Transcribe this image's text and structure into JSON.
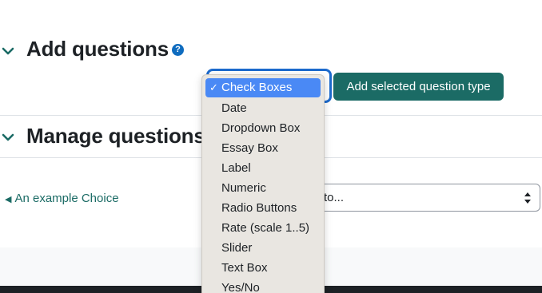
{
  "add_section": {
    "title": "Add questions",
    "help_glyph": "?",
    "add_button_label": "Add selected question type"
  },
  "manage_section": {
    "title": "Manage questions"
  },
  "navigation": {
    "back_link_label": "An example Choice",
    "back_arrow": "◀",
    "jump_select_text": "to..."
  },
  "question_type_dropdown": {
    "check_glyph": "✓",
    "options": [
      "Check Boxes",
      "Date",
      "Dropdown Box",
      "Essay Box",
      "Label",
      "Numeric",
      "Radio Buttons",
      "Rate (scale 1..5)",
      "Slider",
      "Text Box",
      "Yes/No"
    ],
    "selected": "Check Boxes"
  },
  "colors": {
    "accent": "#1b6b65",
    "selection": "#4a89f5",
    "focus_ring": "#1c6acd"
  }
}
